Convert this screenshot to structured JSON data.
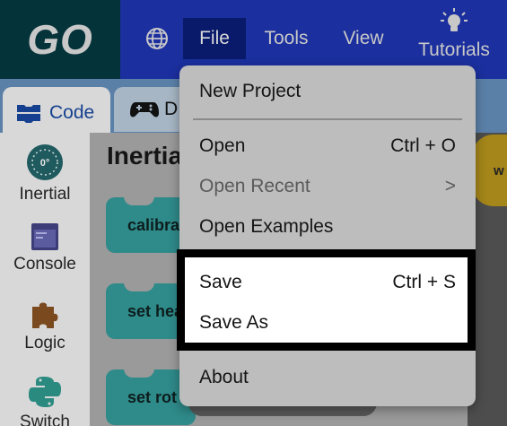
{
  "colors": {
    "topbar": "#1b2f9e",
    "logo_bg": "#05333a",
    "active_menu": "#0a1a6b",
    "dropdown_bg": "#bdbdbd",
    "highlight_border": "#000000",
    "block_teal": "#2f8a8a"
  },
  "header": {
    "logo": "GO",
    "menus": {
      "file": "File",
      "tools": "Tools",
      "view": "View"
    },
    "tutorials": "Tutorials"
  },
  "tabs": {
    "code": "Code",
    "devices": "D"
  },
  "sidebar": {
    "items": [
      {
        "label": "Inertial",
        "icon": "gauge-icon",
        "badge": "0°"
      },
      {
        "label": "Console",
        "icon": "window-icon"
      },
      {
        "label": "Logic",
        "icon": "puzzle-icon"
      },
      {
        "label": "Switch",
        "icon": "python-icon"
      }
    ]
  },
  "flyout": {
    "title": "Inertia",
    "blocks": [
      "calibra",
      "set hea",
      "set rot"
    ]
  },
  "workspace": {
    "block_text": "w"
  },
  "file_menu": {
    "items": [
      {
        "label": "New Project",
        "shortcut": ""
      },
      {
        "label": "Open",
        "shortcut": "Ctrl + O"
      },
      {
        "label": "Open Recent",
        "shortcut": ">"
      },
      {
        "label": "Open Examples",
        "shortcut": ""
      },
      {
        "label": "Save",
        "shortcut": "Ctrl + S"
      },
      {
        "label": "Save As",
        "shortcut": ""
      },
      {
        "label": "About",
        "shortcut": ""
      }
    ]
  }
}
